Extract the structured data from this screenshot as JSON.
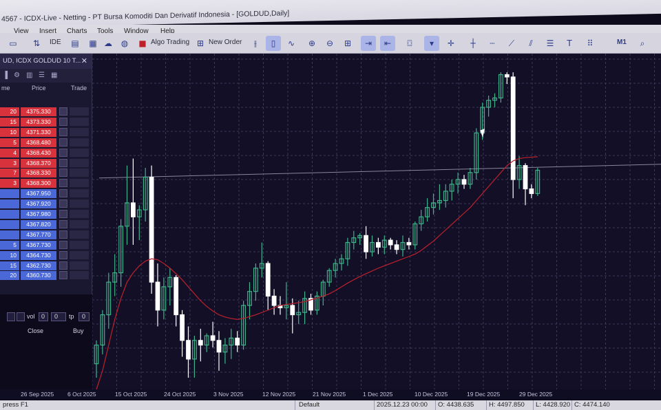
{
  "window": {
    "title": "4567 - ICDX-Live - Netting - PT Bursa Komoditi Dan Derivatif Indonesia - [GOLDUD,Daily]"
  },
  "menu": {
    "items": [
      "View",
      "Insert",
      "Charts",
      "Tools",
      "Window",
      "Help"
    ]
  },
  "toolbar": {
    "ide_label": "IDE",
    "algo_trading_label": "Algo Trading",
    "new_order_label": "New Order",
    "timeframe_label": "M1"
  },
  "panel": {
    "title": "UD, ICDX GOLDUD 10 T...",
    "close_symbol": "✕",
    "col_volume": "me",
    "col_price": "Price",
    "col_trade": "Trade",
    "sell_rows": [
      {
        "volume": "20",
        "price": "4375.330"
      },
      {
        "volume": "15",
        "price": "4373.330"
      },
      {
        "volume": "10",
        "price": "4371.330"
      },
      {
        "volume": "5",
        "price": "4368.480"
      },
      {
        "volume": "4",
        "price": "4368.430"
      },
      {
        "volume": "3",
        "price": "4368.370"
      },
      {
        "volume": "7",
        "price": "4368.330"
      },
      {
        "volume": "3",
        "price": "4368.300"
      }
    ],
    "buy_rows": [
      {
        "volume": "",
        "price": "4367.950"
      },
      {
        "volume": "",
        "price": "4367.920"
      },
      {
        "volume": "",
        "price": "4367.980"
      },
      {
        "volume": "",
        "price": "4367.820"
      },
      {
        "volume": "",
        "price": "4367.770"
      },
      {
        "volume": "5",
        "price": "4367.730"
      },
      {
        "volume": "10",
        "price": "4364.730"
      },
      {
        "volume": "15",
        "price": "4362.730"
      },
      {
        "volume": "20",
        "price": "4360.730"
      }
    ],
    "order": {
      "vol_label": "vol",
      "vol_value": "0",
      "sl_value": "0",
      "tp_label": "tp",
      "tp_value": "0",
      "close_label": "Close",
      "buy_label": "Buy"
    }
  },
  "chart_data": {
    "type": "candlestick",
    "symbol": "GOLDUD",
    "timeframe": "Daily",
    "x_tick_labels": [
      "26 Sep 2025",
      "6 Oct 2025",
      "15 Oct 2025",
      "24 Oct 2025",
      "3 Nov 2025",
      "12 Nov 2025",
      "21 Nov 2025",
      "1 Dec 2025",
      "10 Dec 2025",
      "19 Dec 2025",
      "29 Dec 2025"
    ],
    "ylim": [
      3880,
      4600
    ],
    "candles": [
      {
        "o": 3935,
        "h": 3985,
        "l": 3905,
        "c": 3975
      },
      {
        "o": 3975,
        "h": 4050,
        "l": 3955,
        "c": 4040
      },
      {
        "o": 4040,
        "h": 4130,
        "l": 4010,
        "c": 4110
      },
      {
        "o": 4110,
        "h": 4170,
        "l": 4080,
        "c": 4130
      },
      {
        "o": 4130,
        "h": 4245,
        "l": 4100,
        "c": 4230
      },
      {
        "o": 4230,
        "h": 4360,
        "l": 4190,
        "c": 4280
      },
      {
        "o": 4280,
        "h": 4375,
        "l": 4190,
        "c": 4250
      },
      {
        "o": 4250,
        "h": 4275,
        "l": 4200,
        "c": 4265
      },
      {
        "o": 4265,
        "h": 4355,
        "l": 4240,
        "c": 4335
      },
      {
        "o": 4335,
        "h": 4360,
        "l": 4085,
        "c": 4110
      },
      {
        "o": 4110,
        "h": 4150,
        "l": 4015,
        "c": 4050
      },
      {
        "o": 4050,
        "h": 4120,
        "l": 4030,
        "c": 4100
      },
      {
        "o": 4100,
        "h": 4140,
        "l": 4060,
        "c": 4120
      },
      {
        "o": 4120,
        "h": 4125,
        "l": 4015,
        "c": 4040
      },
      {
        "o": 4040,
        "h": 4050,
        "l": 3950,
        "c": 3985
      },
      {
        "o": 3985,
        "h": 4015,
        "l": 3905,
        "c": 3945
      },
      {
        "o": 3945,
        "h": 3995,
        "l": 3905,
        "c": 3985
      },
      {
        "o": 3985,
        "h": 4010,
        "l": 3940,
        "c": 3975
      },
      {
        "o": 3975,
        "h": 4000,
        "l": 3960,
        "c": 3995
      },
      {
        "o": 3995,
        "h": 4025,
        "l": 3970,
        "c": 3985
      },
      {
        "o": 3985,
        "h": 4005,
        "l": 3920,
        "c": 3960
      },
      {
        "o": 3960,
        "h": 3990,
        "l": 3935,
        "c": 3975
      },
      {
        "o": 3975,
        "h": 4010,
        "l": 3945,
        "c": 3990
      },
      {
        "o": 3990,
        "h": 4005,
        "l": 3960,
        "c": 3975
      },
      {
        "o": 3975,
        "h": 4070,
        "l": 3965,
        "c": 4060
      },
      {
        "o": 4060,
        "h": 4110,
        "l": 4030,
        "c": 4090
      },
      {
        "o": 4090,
        "h": 4150,
        "l": 4070,
        "c": 4140
      },
      {
        "o": 4140,
        "h": 4195,
        "l": 4120,
        "c": 4150
      },
      {
        "o": 4150,
        "h": 4155,
        "l": 4050,
        "c": 4080
      },
      {
        "o": 4080,
        "h": 4095,
        "l": 4040,
        "c": 4060
      },
      {
        "o": 4060,
        "h": 4080,
        "l": 4040,
        "c": 4055
      },
      {
        "o": 4055,
        "h": 4110,
        "l": 4030,
        "c": 4060
      },
      {
        "o": 4060,
        "h": 4075,
        "l": 4000,
        "c": 4040
      },
      {
        "o": 4040,
        "h": 4070,
        "l": 4020,
        "c": 4045
      },
      {
        "o": 4045,
        "h": 4090,
        "l": 4020,
        "c": 4075
      },
      {
        "o": 4075,
        "h": 4085,
        "l": 4040,
        "c": 4050
      },
      {
        "o": 4050,
        "h": 4090,
        "l": 4040,
        "c": 4080
      },
      {
        "o": 4080,
        "h": 4115,
        "l": 4060,
        "c": 4110
      },
      {
        "o": 4110,
        "h": 4140,
        "l": 4100,
        "c": 4135
      },
      {
        "o": 4135,
        "h": 4160,
        "l": 4120,
        "c": 4150
      },
      {
        "o": 4150,
        "h": 4170,
        "l": 4135,
        "c": 4160
      },
      {
        "o": 4160,
        "h": 4205,
        "l": 4145,
        "c": 4195
      },
      {
        "o": 4195,
        "h": 4220,
        "l": 4180,
        "c": 4205
      },
      {
        "o": 4205,
        "h": 4215,
        "l": 4190,
        "c": 4210
      },
      {
        "o": 4210,
        "h": 4230,
        "l": 4160,
        "c": 4175
      },
      {
        "o": 4175,
        "h": 4210,
        "l": 4165,
        "c": 4195
      },
      {
        "o": 4195,
        "h": 4205,
        "l": 4170,
        "c": 4185
      },
      {
        "o": 4185,
        "h": 4210,
        "l": 4170,
        "c": 4200
      },
      {
        "o": 4200,
        "h": 4205,
        "l": 4180,
        "c": 4190
      },
      {
        "o": 4190,
        "h": 4200,
        "l": 4170,
        "c": 4180
      },
      {
        "o": 4180,
        "h": 4210,
        "l": 4165,
        "c": 4195
      },
      {
        "o": 4195,
        "h": 4205,
        "l": 4180,
        "c": 4190
      },
      {
        "o": 4190,
        "h": 4240,
        "l": 4180,
        "c": 4235
      },
      {
        "o": 4235,
        "h": 4265,
        "l": 4220,
        "c": 4250
      },
      {
        "o": 4250,
        "h": 4290,
        "l": 4240,
        "c": 4270
      },
      {
        "o": 4270,
        "h": 4300,
        "l": 4255,
        "c": 4280
      },
      {
        "o": 4280,
        "h": 4320,
        "l": 4265,
        "c": 4285
      },
      {
        "o": 4285,
        "h": 4320,
        "l": 4270,
        "c": 4305
      },
      {
        "o": 4305,
        "h": 4330,
        "l": 4285,
        "c": 4320
      },
      {
        "o": 4320,
        "h": 4345,
        "l": 4300,
        "c": 4330
      },
      {
        "o": 4330,
        "h": 4340,
        "l": 4310,
        "c": 4320
      },
      {
        "o": 4320,
        "h": 4355,
        "l": 4310,
        "c": 4345
      },
      {
        "o": 4345,
        "h": 4440,
        "l": 4330,
        "c": 4430
      },
      {
        "o": 4430,
        "h": 4495,
        "l": 4415,
        "c": 4485
      },
      {
        "o": 4485,
        "h": 4510,
        "l": 4465,
        "c": 4500
      },
      {
        "o": 4500,
        "h": 4515,
        "l": 4485,
        "c": 4505
      },
      {
        "o": 4505,
        "h": 4560,
        "l": 4495,
        "c": 4555
      },
      {
        "o": 4555,
        "h": 4560,
        "l": 4535,
        "c": 4550
      },
      {
        "o": 4550,
        "h": 4560,
        "l": 4290,
        "c": 4330
      },
      {
        "o": 4330,
        "h": 4380,
        "l": 4310,
        "c": 4360
      },
      {
        "o": 4360,
        "h": 4365,
        "l": 4275,
        "c": 4310
      },
      {
        "o": 4310,
        "h": 4320,
        "l": 4290,
        "c": 4300
      },
      {
        "o": 4300,
        "h": 4355,
        "l": 4295,
        "c": 4350
      }
    ],
    "moving_average": [
      3880,
      3920,
      3975,
      4030,
      4075,
      4110,
      4130,
      4145,
      4155,
      4160,
      4158,
      4150,
      4140,
      4128,
      4115,
      4100,
      4085,
      4070,
      4058,
      4048,
      4040,
      4035,
      4032,
      4030,
      4032,
      4036,
      4040,
      4045,
      4050,
      4055,
      4060,
      4062,
      4064,
      4066,
      4068,
      4072,
      4076,
      4080,
      4085,
      4092,
      4100,
      4108,
      4115,
      4122,
      4128,
      4134,
      4140,
      4145,
      4150,
      4155,
      4160,
      4165,
      4170,
      4178,
      4188,
      4198,
      4210,
      4222,
      4234,
      4246,
      4258,
      4270,
      4285,
      4300,
      4315,
      4330,
      4345,
      4360,
      4370,
      4375,
      4377,
      4378,
      4379
    ],
    "horizontal_line": 4348,
    "colors": {
      "bull": "#3fb38a",
      "bear": "#ffffff",
      "ma": "#b4202c",
      "grid": "#3d3a58",
      "hline": "#8a879f"
    }
  },
  "status": {
    "help": "press F1",
    "profile": "Default",
    "date": "2025.12.23 00:00",
    "open": "O: 4438.635",
    "high": "H: 4497.850",
    "low": "L: 4428.920",
    "close": "C: 4474.140"
  }
}
